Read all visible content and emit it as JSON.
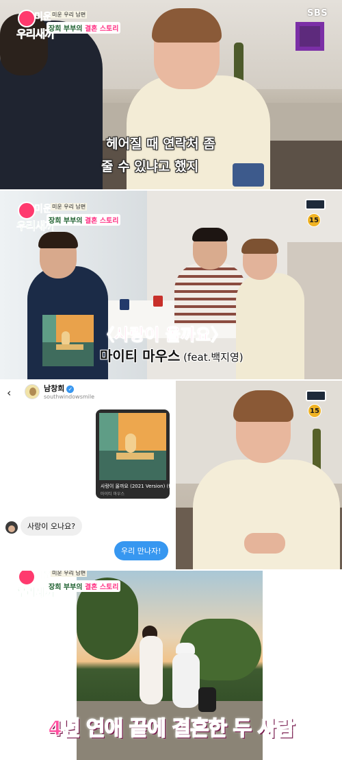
{
  "broadcaster": "SBS",
  "logo": {
    "line1": "미운",
    "line2": "우리새끼",
    "small": "미운 우리 남편",
    "sub_name": "장희 부부의",
    "sub_highlight": "결혼 스토리"
  },
  "panel1": {
    "caption_line1": "헤어질 때 연락처 좀",
    "caption_line2": "줄 수 있냐고 했지"
  },
  "panel2": {
    "rating": "15",
    "song_title": "〈사랑이 올까요〉",
    "song_artist": "마이티 마우스",
    "song_feat": " (feat.백지영)"
  },
  "chat": {
    "back_icon": "‹",
    "contact_name": "남창희",
    "contact_handle": "southwindowsmile",
    "shared_song_title": "사랑이 올까요 (2021 Version) (f",
    "shared_song_artist": "마이티 마우스",
    "incoming_message": "사랑이 오나요?",
    "outgoing_message": "우리 만나자!",
    "colors": {
      "outgoing_bubble": "#3797f0",
      "incoming_bubble": "#efefef"
    }
  },
  "panel4": {
    "rating": "15"
  },
  "panel5": {
    "caption": "4년 연애 끝에 결혼한 두 사람"
  },
  "colors": {
    "caption_pink": "#ff4fa0",
    "song_title_pink": "#ff3f93",
    "logo_green": "#34a854"
  }
}
